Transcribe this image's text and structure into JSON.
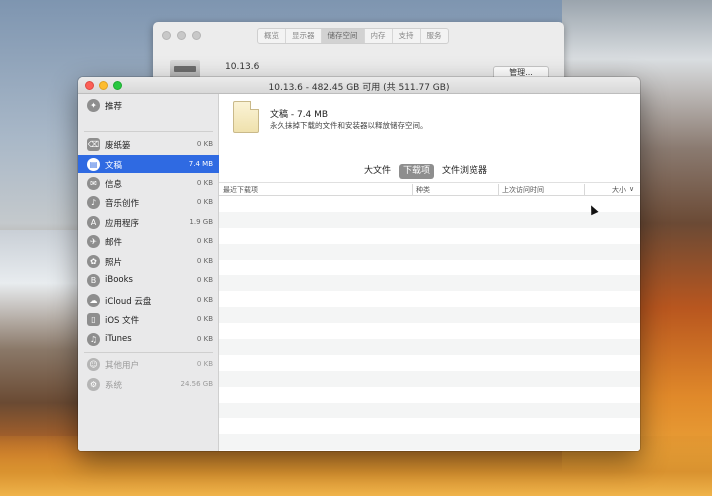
{
  "background_window": {
    "tabs": [
      {
        "label": "概览",
        "active": false
      },
      {
        "label": "显示器",
        "active": false
      },
      {
        "label": "储存空间",
        "active": true
      },
      {
        "label": "内存",
        "active": false
      },
      {
        "label": "支持",
        "active": false
      },
      {
        "label": "服务",
        "active": false
      }
    ],
    "version": "10.13.6",
    "button_label": "管理..."
  },
  "window": {
    "title": "10.13.6 - 482.45 GB 可用 (共 511.77 GB)"
  },
  "sidebar": {
    "items": [
      {
        "label": "推荐",
        "size": "",
        "icon": "lightbulb-icon",
        "glyph": "✦",
        "selected": false,
        "muted": false
      },
      {
        "label": "废纸篓",
        "size": "0 KB",
        "icon": "trash-icon",
        "glyph": "⌫",
        "selected": false,
        "muted": false
      },
      {
        "label": "文稿",
        "size": "7.4 MB",
        "icon": "document-icon",
        "glyph": "▤",
        "selected": true,
        "muted": false
      },
      {
        "label": "信息",
        "size": "0 KB",
        "icon": "messages-icon",
        "glyph": "✉",
        "selected": false,
        "muted": false
      },
      {
        "label": "音乐创作",
        "size": "0 KB",
        "icon": "guitar-icon",
        "glyph": "♪",
        "selected": false,
        "muted": false
      },
      {
        "label": "应用程序",
        "size": "1.9 GB",
        "icon": "app-store-icon",
        "glyph": "A",
        "selected": false,
        "muted": false
      },
      {
        "label": "邮件",
        "size": "0 KB",
        "icon": "mail-icon",
        "glyph": "✈",
        "selected": false,
        "muted": false
      },
      {
        "label": "照片",
        "size": "0 KB",
        "icon": "photos-icon",
        "glyph": "✿",
        "selected": false,
        "muted": false
      },
      {
        "label": "iBooks",
        "size": "0 KB",
        "icon": "book-icon",
        "glyph": "B",
        "selected": false,
        "muted": false
      },
      {
        "label": "iCloud 云盘",
        "size": "0 KB",
        "icon": "cloud-icon",
        "glyph": "☁",
        "selected": false,
        "muted": false
      },
      {
        "label": "iOS 文件",
        "size": "0 KB",
        "icon": "phone-icon",
        "glyph": "▯",
        "selected": false,
        "muted": false
      },
      {
        "label": "iTunes",
        "size": "0 KB",
        "icon": "music-icon",
        "glyph": "♫",
        "selected": false,
        "muted": false
      },
      {
        "label": "其他用户",
        "size": "0 KB",
        "icon": "users-icon",
        "glyph": "☺",
        "selected": false,
        "muted": true
      },
      {
        "label": "系统",
        "size": "24.56 GB",
        "icon": "gear-icon",
        "glyph": "⚙",
        "selected": false,
        "muted": true
      }
    ]
  },
  "content": {
    "doc_title": "文稿 - 7.4 MB",
    "doc_description": "永久抹掉下载的文件和安装器以释放储存空间。",
    "segments": [
      {
        "label": "大文件",
        "active": false
      },
      {
        "label": "下载项",
        "active": true
      },
      {
        "label": "文件浏览器",
        "active": false
      }
    ],
    "table": {
      "headers": [
        "最近下载项",
        "种类",
        "上次访问时间",
        "大小"
      ],
      "sort_indicator": "∨",
      "rows": []
    }
  }
}
